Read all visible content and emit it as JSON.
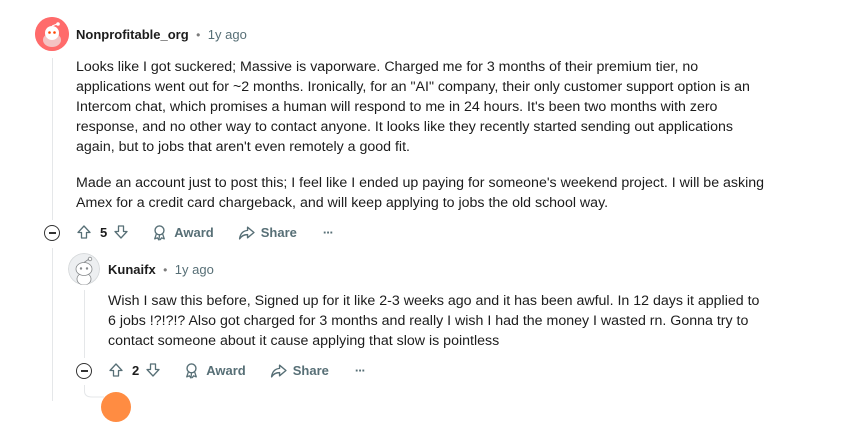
{
  "comments": [
    {
      "author": "Nonprofitable_org",
      "separator": "•",
      "time": "1y ago",
      "paragraphs": [
        "Looks like I got suckered; Massive is vaporware. Charged me for 3 months of their premium tier, no applications went out for ~2 months. Ironically, for an \"AI\" company, their only customer support option is an Intercom chat, which promises a human will respond to me in 24 hours. It's been two months with zero response, and no other way to contact anyone. It looks like they recently started sending out applications again, but to jobs that aren't even remotely a good fit.",
        "Made an account just to post this; I feel like I ended up paying for someone's weekend project. I will be asking Amex for a credit card chargeback, and will keep applying to jobs the old school way."
      ],
      "votes": "5",
      "award_label": "Award",
      "share_label": "Share",
      "more_label": "···",
      "avatar_color": "#ff6b6b"
    },
    {
      "author": "Kunaifx",
      "separator": "•",
      "time": "1y ago",
      "paragraphs": [
        "Wish I saw this before, Signed up for it like 2-3 weeks ago and it has been awful. In 12 days it applied to 6 jobs !?!?!? Also got charged for 3 months and really I wish I had the money I wasted rn. Gonna try to contact someone about it cause applying that slow is pointless"
      ],
      "votes": "2",
      "award_label": "Award",
      "share_label": "Share",
      "more_label": "···",
      "avatar_color": "#d7dadc"
    }
  ],
  "next_avatar_color": "#ff8c42",
  "icons": [
    "upvote-icon",
    "downvote-icon",
    "award-icon",
    "share-icon",
    "collapse-icon",
    "more-icon"
  ]
}
